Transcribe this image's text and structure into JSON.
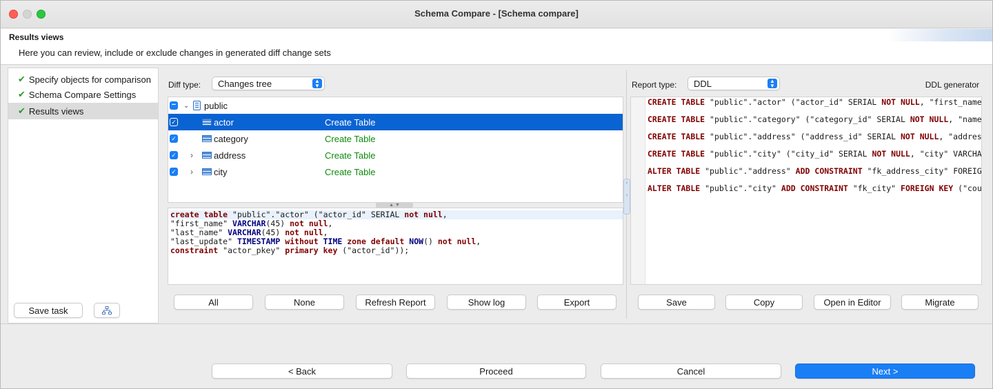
{
  "window": {
    "title": "Schema Compare - [Schema compare]"
  },
  "header": {
    "title": "Results views",
    "description": "Here you can review, include or exclude changes in generated diff change sets"
  },
  "nav": {
    "items": [
      {
        "label": "Specify objects for comparison",
        "done": true
      },
      {
        "label": "Schema Compare Settings",
        "done": true
      },
      {
        "label": "Results views",
        "done": true,
        "selected": true
      }
    ],
    "save_task": "Save task",
    "check_glyph": "✔"
  },
  "diff": {
    "label": "Diff type:",
    "value": "Changes tree",
    "tree": {
      "schema": "public",
      "rows": [
        {
          "name": "actor",
          "action": "Create Table",
          "checked": true,
          "selected": true,
          "expandable": false
        },
        {
          "name": "category",
          "action": "Create Table",
          "checked": true,
          "selected": false,
          "expandable": false
        },
        {
          "name": "address",
          "action": "Create Table",
          "checked": true,
          "selected": false,
          "expandable": true
        },
        {
          "name": "city",
          "action": "Create Table",
          "checked": true,
          "selected": false,
          "expandable": true
        }
      ]
    },
    "sql_preview": [
      "create table \"public\".\"actor\" (\"actor_id\" SERIAL not null,",
      "\"first_name\" VARCHAR(45) not null,",
      "\"last_name\" VARCHAR(45) not null,",
      "\"last_update\" TIMESTAMP without TIME zone default NOW() not null,",
      "constraint \"actor_pkey\" primary key (\"actor_id\"));"
    ],
    "buttons": {
      "all": "All",
      "none": "None",
      "refresh": "Refresh Report",
      "show_log": "Show log",
      "export": "Export"
    }
  },
  "report": {
    "label": "Report type:",
    "value": "DDL",
    "generator": "DDL generator",
    "ddl_lines": [
      "CREATE TABLE \"public\".\"actor\" (\"actor_id\" SERIAL NOT NULL, \"first_name",
      "CREATE TABLE \"public\".\"category\" (\"category_id\" SERIAL NOT NULL, \"name",
      "CREATE TABLE \"public\".\"address\" (\"address_id\" SERIAL NOT NULL, \"addres",
      "CREATE TABLE \"public\".\"city\" (\"city_id\" SERIAL NOT NULL, \"city\" VARCHA",
      "ALTER TABLE \"public\".\"address\" ADD CONSTRAINT \"fk_address_city\" FOREIG",
      "ALTER TABLE \"public\".\"city\" ADD CONSTRAINT \"fk_city\" FOREIGN KEY (\"cou"
    ],
    "buttons": {
      "save": "Save",
      "copy": "Copy",
      "open_editor": "Open in Editor",
      "migrate": "Migrate"
    }
  },
  "footer": {
    "back": "< Back",
    "proceed": "Proceed",
    "cancel": "Cancel",
    "next": "Next >"
  },
  "colors": {
    "accent": "#1a7ef5",
    "selection": "#0a63d2",
    "action_green": "#0c8a0c",
    "check_green": "#2a9a2a"
  }
}
